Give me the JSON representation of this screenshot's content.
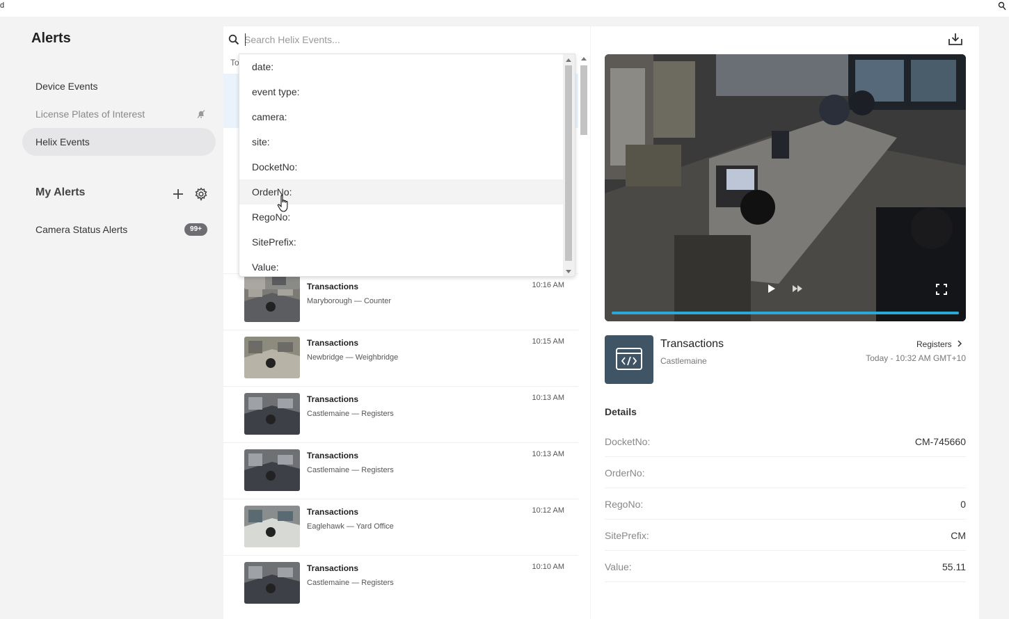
{
  "sidebar": {
    "title": "Alerts",
    "items": [
      {
        "label": "Device Events"
      },
      {
        "label": "License Plates of Interest"
      },
      {
        "label": "Helix Events"
      }
    ],
    "my_alerts_label": "My Alerts",
    "my_alerts_items": [
      {
        "label": "Camera Status Alerts",
        "badge": "99+"
      }
    ]
  },
  "search": {
    "placeholder": "Search Helix Events...",
    "partial_header": "To",
    "suggestions": [
      "date:",
      "event type:",
      "camera:",
      "site:",
      "DocketNo:",
      "OrderNo:",
      "RegoNo:",
      "SitePrefix:",
      "Value:"
    ],
    "hovered": "OrderNo:"
  },
  "events": [
    {
      "title": "Transactions",
      "site": "Maryborough",
      "camera": "Counter",
      "time": "10:16 AM"
    },
    {
      "title": "Transactions",
      "site": "Newbridge",
      "camera": "Weighbridge",
      "time": "10:15 AM"
    },
    {
      "title": "Transactions",
      "site": "Castlemaine",
      "camera": "Registers",
      "time": "10:13 AM"
    },
    {
      "title": "Transactions",
      "site": "Castlemaine",
      "camera": "Registers",
      "time": "10:13 AM"
    },
    {
      "title": "Transactions",
      "site": "Eaglehawk",
      "camera": "Yard Office",
      "time": "10:12 AM"
    },
    {
      "title": "Transactions",
      "site": "Castlemaine",
      "camera": "Registers",
      "time": "10:10 AM"
    }
  ],
  "event_sep": " — ",
  "detail": {
    "title": "Transactions",
    "site": "Castlemaine",
    "camera_link": "Registers",
    "datetime": "Today - 10:32 AM GMT+10",
    "video_progress": 1.0,
    "details_header": "Details",
    "rows": [
      {
        "key": "DocketNo:",
        "value": "CM-745660"
      },
      {
        "key": "OrderNo:",
        "value": ""
      },
      {
        "key": "RegoNo:",
        "value": "0"
      },
      {
        "key": "SitePrefix:",
        "value": "CM"
      },
      {
        "key": "Value:",
        "value": "55.11"
      }
    ]
  },
  "colors": {
    "accent": "#2aa8d8",
    "icon_box": "#3f5565",
    "badge": "#6e6e72",
    "active_nav": "#e6e6e8"
  },
  "icons": [
    "search-icon",
    "bell-off-icon",
    "plus-icon",
    "gear-icon",
    "download-icon",
    "play-icon",
    "fast-forward-icon",
    "fullscreen-icon",
    "code-window-icon",
    "chevron-right-icon",
    "hand-cursor-icon"
  ]
}
